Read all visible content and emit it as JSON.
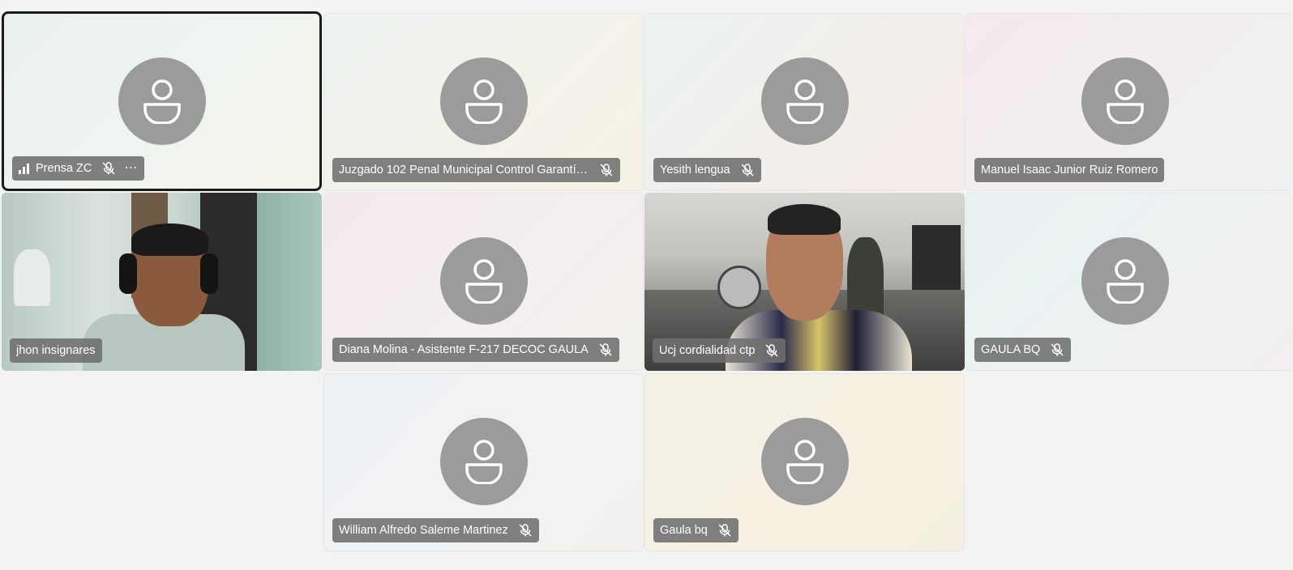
{
  "participants": [
    {
      "name": "Prensa ZC",
      "muted": true,
      "active": true
    },
    {
      "name": "Juzgado 102 Penal Municipal Control Garantía...",
      "muted": true
    },
    {
      "name": "Yesith lengua",
      "muted": true
    },
    {
      "name": "Manuel Isaac Junior Ruiz Romero",
      "muted": false
    },
    {
      "name": "jhon insignares",
      "muted": false,
      "video": true
    },
    {
      "name": "Diana Molina - Asistente F-217 DECOC GAULA",
      "muted": true
    },
    {
      "name": "Ucj cordialidad ctp",
      "muted": true,
      "video": true
    },
    {
      "name": "GAULA BQ",
      "muted": true
    },
    {
      "name": "William Alfredo Saleme Martinez",
      "muted": true
    },
    {
      "name": "Gaula bq",
      "muted": true
    }
  ],
  "more_options": "⋯"
}
